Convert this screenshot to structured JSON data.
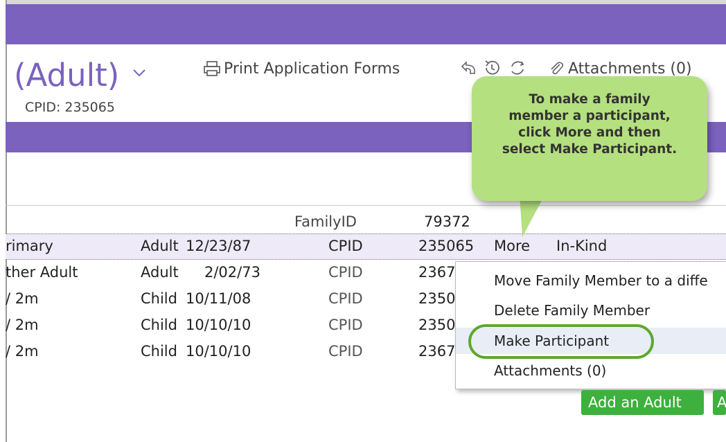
{
  "header": {
    "title": "(Adult)",
    "cpid_label": "CPID: 235065",
    "print_label": "Print Application Forms",
    "attachments_label": "Attachments (0)"
  },
  "family": {
    "family_id_label": "FamilyID",
    "family_id_value": "79372",
    "rows": [
      {
        "name": "rimary",
        "type": "Adult",
        "dob": "12/23/87",
        "id_label": "CPID",
        "id_value": "235065",
        "more": "More",
        "extra": "In-Kind"
      },
      {
        "name": "ther Adult",
        "type": "Adult",
        "dob": "2/02/73",
        "id_label": "CPID",
        "id_value": "2367"
      },
      {
        "name": "/ 2m",
        "type": "Child",
        "dob": "10/11/08",
        "id_label": "CPID",
        "id_value": "2350"
      },
      {
        "name": "/ 2m",
        "type": "Child",
        "dob": "10/10/10",
        "id_label": "CPID",
        "id_value": "2350"
      },
      {
        "name": "/ 2m",
        "type": "Child",
        "dob": "10/10/10",
        "id_label": "CPID",
        "id_value": "2367"
      }
    ]
  },
  "context_menu": {
    "items": [
      "Move Family Member to a diffe",
      "Delete Family Member",
      "Make Participant",
      "Attachments (0)"
    ]
  },
  "callout": {
    "lines": [
      "To make a family",
      "member a participant,",
      "click More and then",
      "select Make Participant."
    ]
  },
  "buttons": {
    "add_adult": "Add an Adult",
    "partial": "A"
  },
  "colors": {
    "brand_purple": "#7b62bf",
    "callout_green": "#b5e07f",
    "highlight_green": "#5ea82e",
    "button_green": "#3db03d"
  },
  "icons": [
    "chevron-down-icon",
    "printer-icon",
    "undo-icon",
    "history-icon",
    "refresh-icon",
    "paperclip-icon"
  ]
}
